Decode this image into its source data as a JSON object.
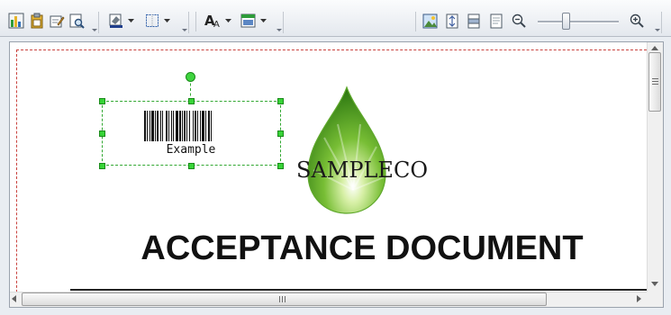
{
  "toolbar": {
    "icons": [
      "chart-icon",
      "paste-icon",
      "edit-icon",
      "preview-icon",
      "fill-color-icon",
      "border-icon",
      "font-icon",
      "layout-icon",
      "picture-icon",
      "fit-page-icon",
      "fit-width-icon",
      "single-page-icon",
      "zoom-out-icon",
      "zoom-in-icon"
    ],
    "zoom_level": 0.33
  },
  "document": {
    "barcode_text": "Example",
    "logo_text": "SAMPLECO",
    "heading": "ACCEPTANCE DOCUMENT"
  },
  "colors": {
    "selection": "#32a832",
    "margin_guide": "#c9433f",
    "drop_green": "#4c9f23"
  }
}
